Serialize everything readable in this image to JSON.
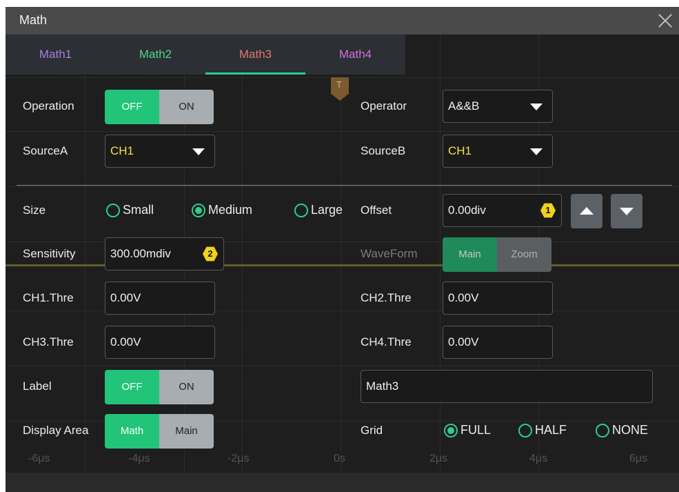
{
  "title": "Math",
  "tabs": [
    {
      "label": "Math1",
      "color": "#a87ee6"
    },
    {
      "label": "Math2",
      "color": "#4fd68c"
    },
    {
      "label": "Math3",
      "color": "#e07a6a"
    },
    {
      "label": "Math4",
      "color": "#d070e0"
    }
  ],
  "active_tab": "Math3",
  "left": {
    "operation_label": "Operation",
    "operation_off": "OFF",
    "operation_on": "ON",
    "sourceA_label": "SourceA",
    "sourceA_value": "CH1",
    "size_label": "Size",
    "size_options": [
      "Small",
      "Medium",
      "Large"
    ],
    "size_selected": "Medium",
    "sensitivity_label": "Sensitivity",
    "sensitivity_value": "300.00mdiv",
    "sensitivity_knob": "2",
    "ch1_label": "CH1.Thre",
    "ch1_value": "0.00V",
    "ch3_label": "CH3.Thre",
    "ch3_value": "0.00V",
    "label_label": "Label",
    "label_off": "OFF",
    "label_on": "ON",
    "display_area_label": "Display Area",
    "display_area_math": "Math",
    "display_area_main": "Main"
  },
  "right": {
    "operator_label": "Operator",
    "operator_value": "A&&B",
    "sourceB_label": "SourceB",
    "sourceB_value": "CH1",
    "offset_label": "Offset",
    "offset_value": "0.00div",
    "offset_knob": "1",
    "waveform_label": "WaveForm",
    "waveform_main": "Main",
    "waveform_zoom": "Zoom",
    "ch2_label": "CH2.Thre",
    "ch2_value": "0.00V",
    "ch4_label": "CH4.Thre",
    "ch4_value": "0.00V",
    "label_text": "Math3",
    "grid_label": "Grid",
    "grid_options": [
      "FULL",
      "HALF",
      "NONE"
    ],
    "grid_selected": "FULL"
  },
  "scope": {
    "trigger_marker": "T",
    "time_ticks": [
      "-6μs",
      "-4μs",
      "-2μs",
      "0s",
      "2μs",
      "4μs",
      "6μs"
    ]
  }
}
